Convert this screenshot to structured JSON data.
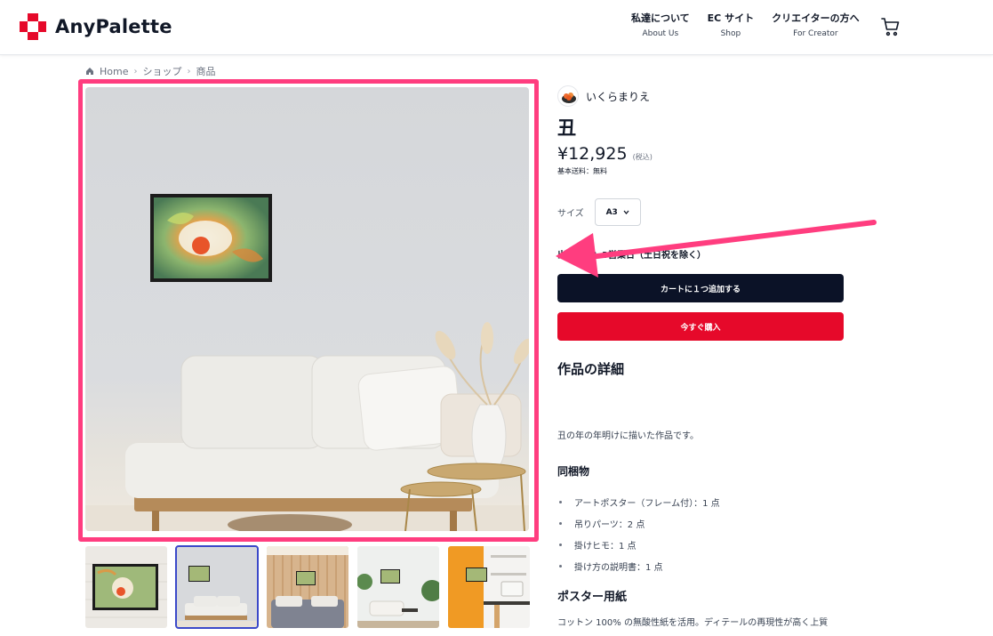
{
  "header": {
    "logo_text": "AnyPalette",
    "nav": [
      {
        "jp": "私達について",
        "en": "About Us"
      },
      {
        "jp": "EC サイト",
        "en": "Shop"
      },
      {
        "jp": "クリエイターの方へ",
        "en": "For Creator"
      }
    ],
    "cart_icon": "cart-icon"
  },
  "breadcrumb": {
    "home_icon": "home-icon",
    "items": [
      "Home",
      "ショップ",
      "商品"
    ]
  },
  "product": {
    "artist": "いくらまりえ",
    "title": "丑",
    "price": "¥12,925",
    "tax_note": "(税込)",
    "shipping": "基本送料：無料",
    "size_label": "サイズ",
    "size_value": "A3",
    "shipping_note": "出荷目安：3営業日（土日祝を除く）",
    "add_to_cart": "カートに１つ追加する",
    "buy_now": "今すぐ購入",
    "details_title": "作品の詳細",
    "description": "丑の年の年明けに描いた作品です。",
    "bundle_title": "同梱物",
    "bundle_items": [
      "アートポスター（フレーム付）：1 点",
      "吊りパーツ：2 点",
      "掛けヒモ：1 点",
      "掛け方の説明書：1 点"
    ],
    "paper_title": "ポスター用紙",
    "paper_desc": "コットン 100% の無酸性紙を活用。ディテールの再現性が高く上質"
  },
  "gallery": {
    "thumbnails": [
      "thumb-closeup",
      "thumb-living-room",
      "thumb-bedroom",
      "thumb-lounge",
      "thumb-orange-wall"
    ],
    "active_index": 1
  },
  "annotation": {
    "highlight_color": "#ff3d7f",
    "arrow_color": "#ff3d7f"
  },
  "colors": {
    "brand_red": "#e6092a",
    "cart_button": "#0b1227"
  }
}
